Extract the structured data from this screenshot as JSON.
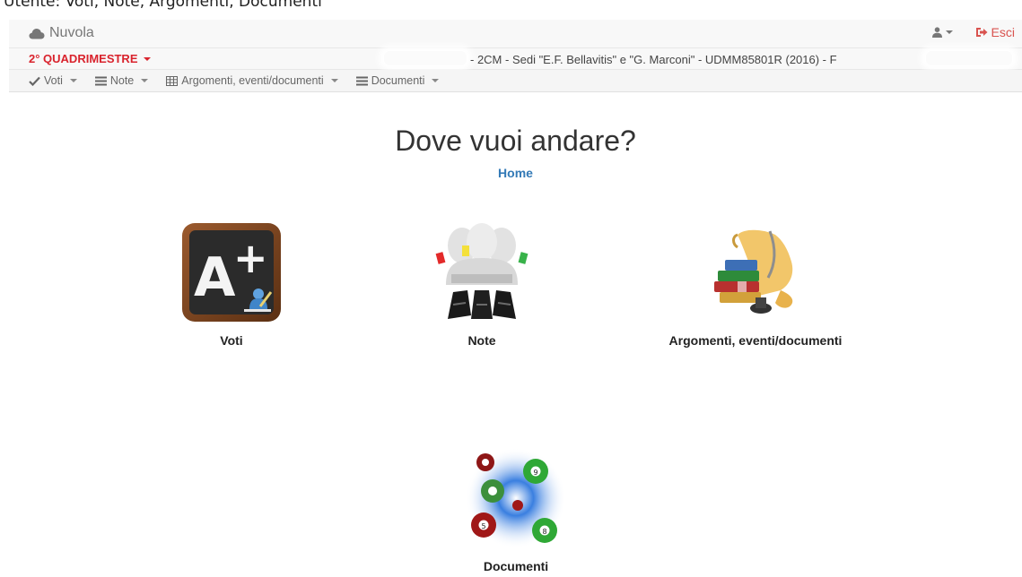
{
  "top_text": "Utente: Voti, Note, Argomenti, Documenti",
  "navbar": {
    "brand": "Nuvola",
    "logout_label": "Esci"
  },
  "period": {
    "label": "2° QUADRIMESTRE"
  },
  "class_info": "- 2CM - Sedi \"E.F. Bellavitis\" e \"G. Marconi\" - UDMM85801R (2016) - F",
  "menu": [
    {
      "label": "Voti",
      "icon": "check-icon"
    },
    {
      "label": "Note",
      "icon": "list-icon"
    },
    {
      "label": "Argomenti, eventi/documenti",
      "icon": "table-icon"
    },
    {
      "label": "Documenti",
      "icon": "list-icon"
    }
  ],
  "main": {
    "title": "Dove vuoi andare?",
    "breadcrumb": "Home",
    "tiles": [
      {
        "label": "Voti",
        "icon": "grades-chalkboard-icon"
      },
      {
        "label": "Note",
        "icon": "students-notes-icon"
      },
      {
        "label": "Argomenti, eventi/documenti",
        "icon": "scroll-books-icon"
      },
      {
        "label": "Documenti",
        "icon": "billiard-balls-icon"
      }
    ]
  },
  "colors": {
    "accent_red": "#d9232d",
    "link_blue": "#337ab7",
    "navbar_bg": "#f8f8f8"
  }
}
